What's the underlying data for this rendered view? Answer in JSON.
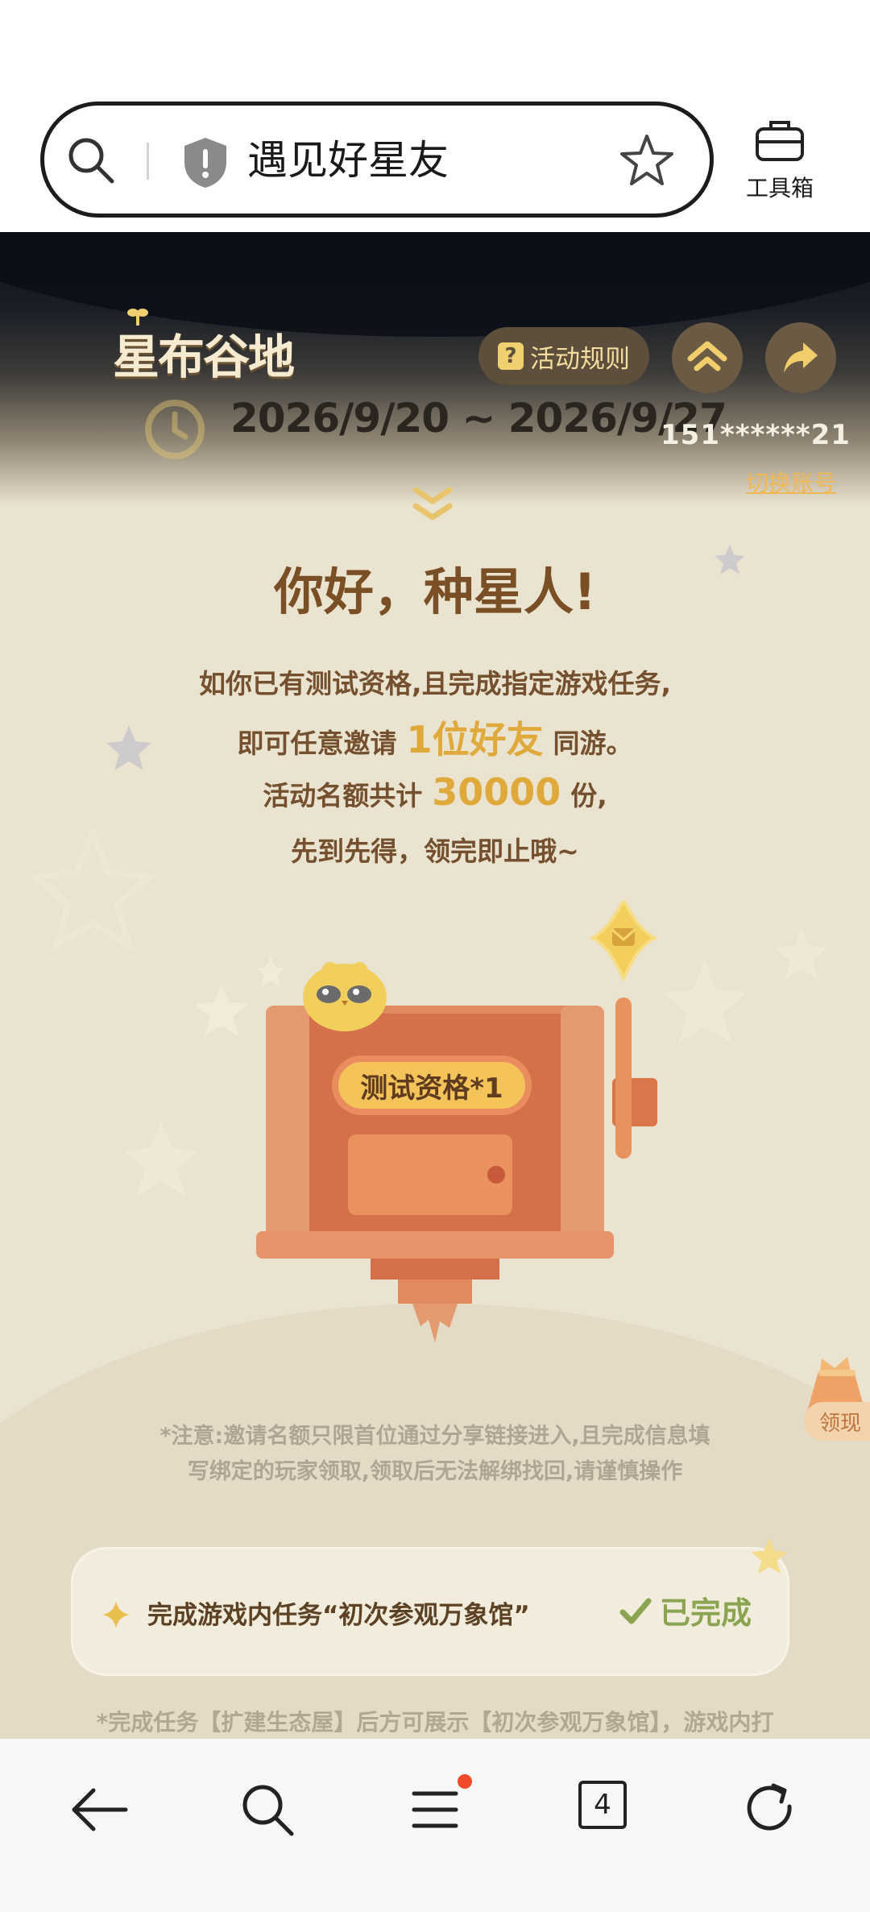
{
  "browser": {
    "url_bar": {
      "title": "遇见好星友"
    },
    "toolbox_label": "工具箱"
  },
  "header": {
    "logo": "星布谷地",
    "rules_label": "活动规则",
    "date_range": "2026/9/20 ~ 2026/9/27",
    "account_id": "151******21",
    "switch_account_label": "切换账号"
  },
  "main": {
    "greeting": "你好，种星人!",
    "desc1": "如你已有测试资格,且完成指定游戏任务,",
    "desc2_pre": "即可任意邀请",
    "desc2_hl": "1位好友",
    "desc2_post": "同游。",
    "desc3_pre": "活动名额共计",
    "desc3_hl": "30000",
    "desc3_post": "份,",
    "desc4": "先到先得，领完即止哦~",
    "qualification_badge": "测试资格*1",
    "claim_label": "领现",
    "note_line1": "*注意:邀请名额只限首位通过分享链接进入,且完成信息填",
    "note_line2": "写绑定的玩家领取,领取后无法解绑找回,请谨慎操作",
    "task": {
      "text": "完成游戏内任务“初次参观万象馆”",
      "status": "已完成"
    },
    "footer_note": "*完成任务【扩建生态屋】后方可展示【初次参观万象馆】，游戏内打"
  },
  "bottom_nav": {
    "tab_count": "4"
  },
  "colors": {
    "page_bg": "#eae3d0",
    "accent_gold": "#e0a93b",
    "text_brown": "#74502f",
    "done_green": "#8aa452",
    "badge_yellow": "#f4c35a",
    "machine_orange": "#e08a5e",
    "notification_red": "#f04a2a"
  },
  "icons": {
    "url_bar": [
      "search-icon",
      "shield-icon",
      "star-icon"
    ],
    "toolbox": "toolbox-icon",
    "header": [
      "help-icon",
      "home-icon",
      "share-icon",
      "clock-icon",
      "chevron-down-icon"
    ],
    "task": [
      "diamond-icon",
      "check-icon"
    ],
    "bottom_nav": [
      "back-arrow-icon",
      "search-icon",
      "menu-icon",
      "tabs-icon",
      "refresh-icon"
    ]
  }
}
